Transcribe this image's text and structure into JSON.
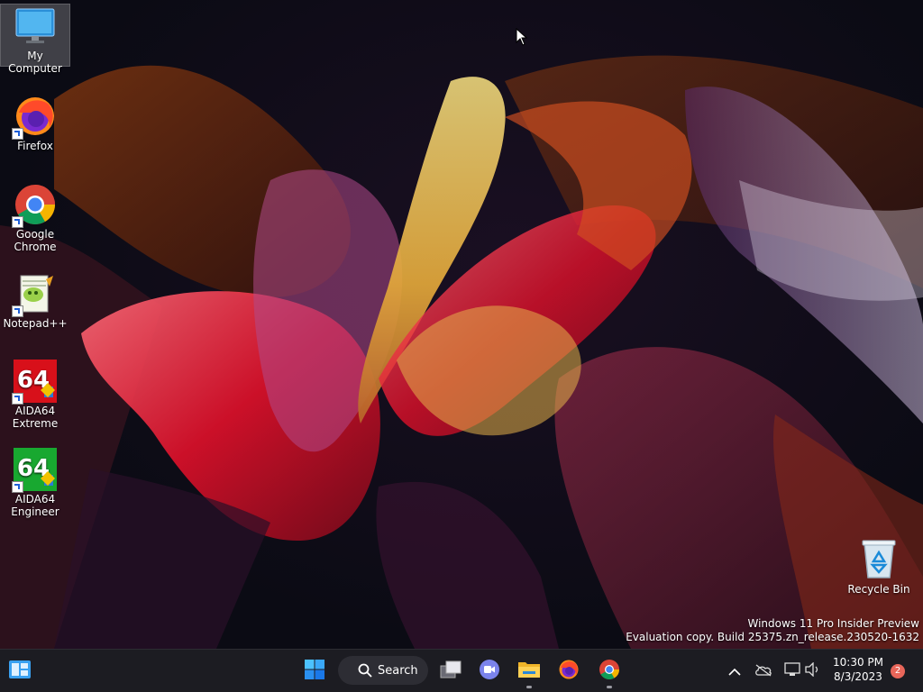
{
  "desktop": {
    "icons": [
      {
        "label": "My Computer",
        "icon": "monitor-icon"
      },
      {
        "label": "Firefox",
        "icon": "firefox-icon"
      },
      {
        "label": "Google Chrome",
        "icon": "chrome-icon"
      },
      {
        "label": "Notepad++",
        "icon": "notepadpp-icon"
      },
      {
        "label": "AIDA64 Extreme",
        "icon": "aida64-extreme-icon"
      },
      {
        "label": "AIDA64 Engineer",
        "icon": "aida64-engineer-icon"
      },
      {
        "label": "Recycle Bin",
        "icon": "recycle-bin-icon"
      }
    ],
    "aida_badge": "64",
    "watermark": {
      "line1": "Windows 11 Pro Insider Preview",
      "line2": "Evaluation copy. Build 25375.zn_release.230520-1632"
    }
  },
  "taskbar": {
    "search_label": "Search",
    "pinned": [
      "widgets-icon",
      "start-icon",
      "search-icon",
      "task-view-icon",
      "teams-chat-icon",
      "file-explorer-icon",
      "firefox-icon",
      "chrome-icon"
    ],
    "tray": [
      "chevron-up-icon",
      "onedrive-icon",
      "network-icon",
      "volume-icon"
    ],
    "time": "10:30 PM",
    "date": "8/3/2023",
    "notification_count": "2"
  },
  "colors": {
    "taskbar_bg": "#1c1c22",
    "accent": "#3aa0f0",
    "notification": "#e8665a"
  }
}
